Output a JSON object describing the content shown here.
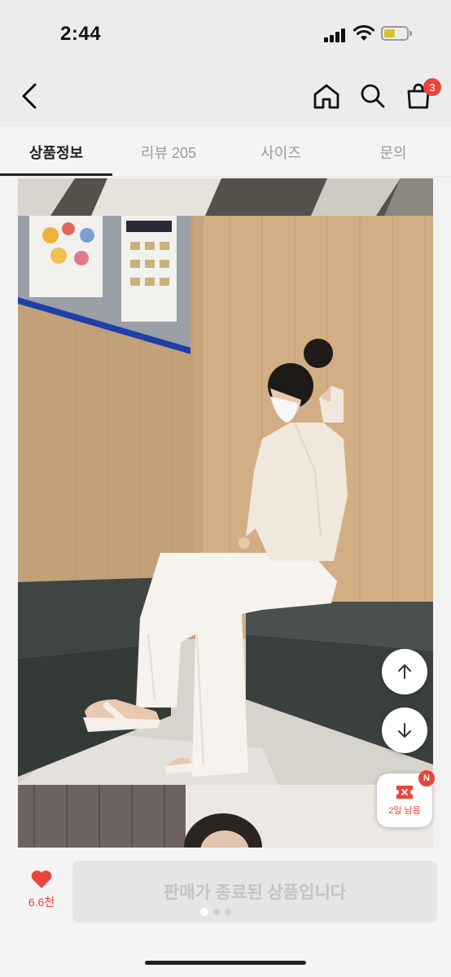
{
  "status_bar": {
    "time": "2:44",
    "battery_level": 0.5,
    "battery_color": "#d8c12a"
  },
  "nav": {
    "back_icon": "chevron-left-icon",
    "home_icon": "home-icon",
    "search_icon": "search-icon",
    "cart_icon": "bag-icon",
    "cart_count": "3"
  },
  "tabs": [
    {
      "label": "상품정보",
      "active": true
    },
    {
      "label": "리뷰 205",
      "active": false
    },
    {
      "label": "사이즈",
      "active": false
    },
    {
      "label": "문의",
      "active": false
    }
  ],
  "floating": {
    "scroll_up_icon": "arrow-up-icon",
    "scroll_down_icon": "arrow-down-icon",
    "coupon_icon": "ticket-icon",
    "coupon_badge": "N",
    "coupon_label": "2일 남음"
  },
  "bottom": {
    "like_icon": "heart-icon",
    "like_count": "6.6천",
    "purchase_label": "판매가 종료된 상품입니다"
  },
  "colors": {
    "accent": "#e8453c",
    "disabled_button": "#e5e5e5",
    "disabled_text": "#c4c4c4"
  }
}
